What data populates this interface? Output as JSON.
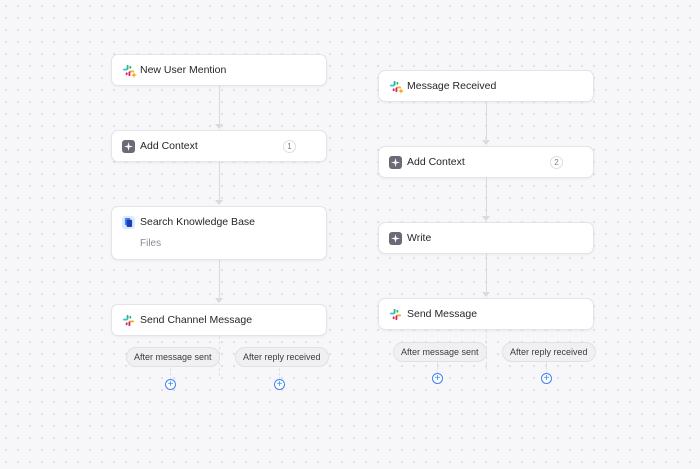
{
  "colors": {
    "accent": "#3b82f6",
    "slack_green": "#2eb67d",
    "slack_blue": "#36c5f0",
    "slack_red": "#e01e5a",
    "slack_yellow": "#ecb22e"
  },
  "left_flow": {
    "trigger": {
      "label": "New User Mention",
      "icon": "slack-icon"
    },
    "context": {
      "label": "Add Context",
      "badge": "1",
      "icon": "sparkle-icon"
    },
    "search": {
      "label": "Search Knowledge Base",
      "sublabel": "Files",
      "icon": "knowledge-base-icon"
    },
    "send": {
      "label": "Send Channel Message",
      "icon": "slack-icon"
    },
    "branches": [
      "After message sent",
      "After reply received"
    ]
  },
  "right_flow": {
    "trigger": {
      "label": "Message Received",
      "icon": "slack-icon"
    },
    "context": {
      "label": "Add Context",
      "badge": "2",
      "icon": "sparkle-icon"
    },
    "write": {
      "label": "Write",
      "icon": "sparkle-icon"
    },
    "send": {
      "label": "Send Message",
      "icon": "slack-icon"
    },
    "branches": [
      "After message sent",
      "After reply received"
    ]
  },
  "add_symbol": "+"
}
